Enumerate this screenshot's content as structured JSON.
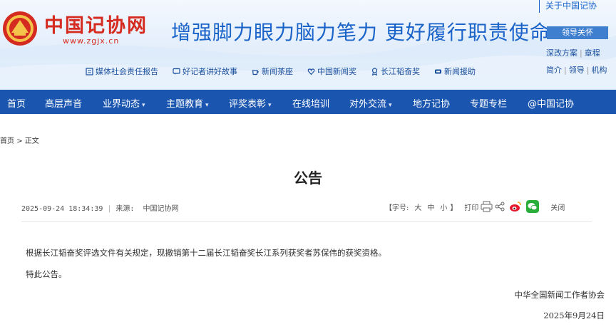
{
  "header": {
    "logo_title": "中国记协网",
    "logo_url": "www.zgjx.cn",
    "slogan": "增强脚力眼力脑力笔力 更好履行职责使命",
    "sublinks": [
      {
        "label": "媒体社会责任报告",
        "icon": "report-icon"
      },
      {
        "label": "好记者讲好故事",
        "icon": "chat-icon"
      },
      {
        "label": "新闻茶座",
        "icon": "teacup-icon"
      },
      {
        "label": "中国新闻奖",
        "icon": "heart-award-icon"
      },
      {
        "label": "长江韬奋奖",
        "icon": "medal-icon"
      },
      {
        "label": "新闻援助",
        "icon": "hand-icon"
      }
    ],
    "about_label": "关于中国记协",
    "leader_label": "领导关怀",
    "side_links_row1": [
      "深改方案",
      "章程"
    ],
    "side_links_row2": [
      "简介",
      "领导",
      "机构"
    ]
  },
  "nav": {
    "items": [
      {
        "label": "首页",
        "dropdown": false
      },
      {
        "label": "高层声音",
        "dropdown": false
      },
      {
        "label": "业界动态",
        "dropdown": true
      },
      {
        "label": "主题教育",
        "dropdown": true
      },
      {
        "label": "评奖表彰",
        "dropdown": true
      },
      {
        "label": "在线培训",
        "dropdown": false
      },
      {
        "label": "对外交流",
        "dropdown": true
      },
      {
        "label": "地方记协",
        "dropdown": false
      },
      {
        "label": "专题专栏",
        "dropdown": false
      },
      {
        "label": "@中国记协",
        "dropdown": false
      }
    ]
  },
  "breadcrumb": {
    "home": "首页",
    "separator": ">",
    "current": "正文"
  },
  "article": {
    "title": "公告",
    "datetime": "2025-09-24 18:34:39",
    "source_label": "来源:",
    "source": "中国记协网",
    "font_size_label": "【字号:",
    "font_size_large": "大",
    "font_size_medium": "中",
    "font_size_small": "小",
    "font_size_close": "】",
    "print_label": "打印",
    "close_label": "关闭",
    "paragraphs": [
      "根据长江韬奋奖评选文件有关规定，现撤销第十二届长江韬奋奖长江系列获奖者苏保伟的获奖资格。",
      "特此公告。"
    ],
    "signature_org": "中华全国新闻工作者协会",
    "signature_date": "2025年9月24日"
  },
  "colors": {
    "brand_red": "#d52a1f",
    "brand_blue": "#1a63c9",
    "nav_blue": "#1a56b0"
  }
}
